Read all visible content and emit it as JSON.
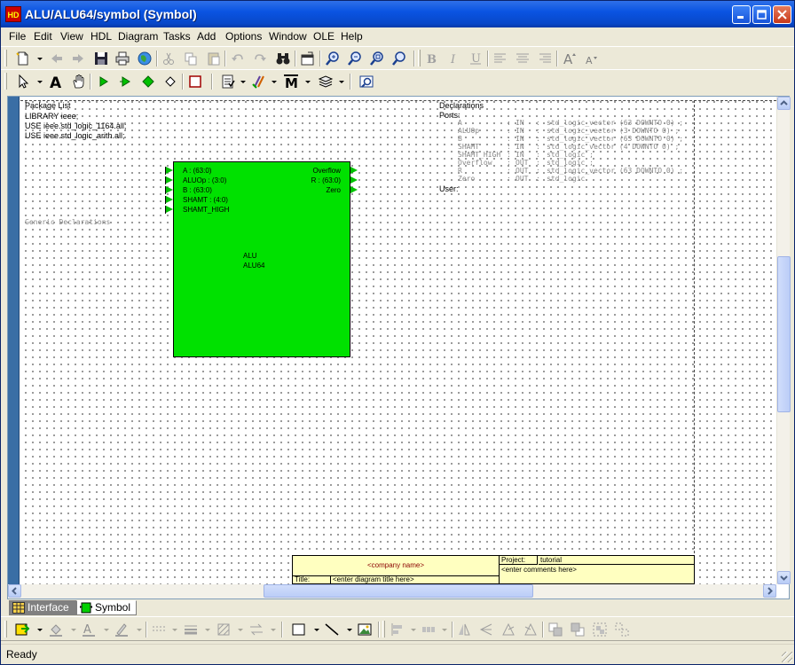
{
  "window": {
    "app_icon_text": "HD",
    "title": "ALU/ALU64/symbol (Symbol)"
  },
  "menubar": {
    "items": [
      "File",
      "Edit",
      "View",
      "HDL",
      "Diagram",
      "Tasks",
      "Add",
      "Options",
      "Window",
      "OLE",
      "Help"
    ]
  },
  "canvas": {
    "package_list": {
      "heading": "Package List",
      "lines": [
        "LIBRARY ieee;",
        "USE ieee.std_logic_1164.all;",
        "USE ieee.std_logic_arith.all;"
      ]
    },
    "generic_declarations": "Generic Declarations",
    "declarations": {
      "heading": "Declarations",
      "ports_label": "Ports:",
      "ports": [
        {
          "name": "A",
          "dir": "IN",
          "type": "std_logic_vector (63 DOWNTO 0) ;"
        },
        {
          "name": "ALUOp",
          "dir": "IN",
          "type": "std_logic_vector (3 DOWNTO 0) ;"
        },
        {
          "name": "B",
          "dir": "IN",
          "type": "std_logic_vector (63 DOWNTO 0) ;"
        },
        {
          "name": "SHAMT",
          "dir": "IN",
          "type": "std_logic_vector (4 DOWNTO 0) ;"
        },
        {
          "name": "SHAMT_HIGH",
          "dir": "IN",
          "type": "std_logic ;"
        },
        {
          "name": "Overflow",
          "dir": "OUT",
          "type": "std_logic ;"
        },
        {
          "name": "R",
          "dir": "OUT",
          "type": "std_logic_vector (63 DOWNTO 0) ;"
        },
        {
          "name": "Zero",
          "dir": "OUT",
          "type": "std_logic"
        }
      ],
      "user_label": "User:"
    },
    "symbol": {
      "library": "ALU",
      "name": "ALU64",
      "body_color": "#00e100",
      "in_ports": [
        "A : (63:0)",
        "ALUOp : (3:0)",
        "B : (63:0)",
        "SHAMT : (4:0)",
        "SHAMT_HIGH"
      ],
      "out_ports": [
        "Overflow",
        "R : (63:0)",
        "Zero"
      ]
    },
    "title_block": {
      "company": "<company name>",
      "project_label": "Project:",
      "project_value": "tutorial",
      "comments": "<enter comments here>",
      "title_label": "Title:",
      "title_value": "<enter diagram title here>",
      "fill_color": "#ffffc0"
    }
  },
  "tabs": [
    {
      "label": "Interface",
      "active": false
    },
    {
      "label": "Symbol",
      "active": true
    }
  ],
  "statusbar": {
    "text": "Ready"
  }
}
